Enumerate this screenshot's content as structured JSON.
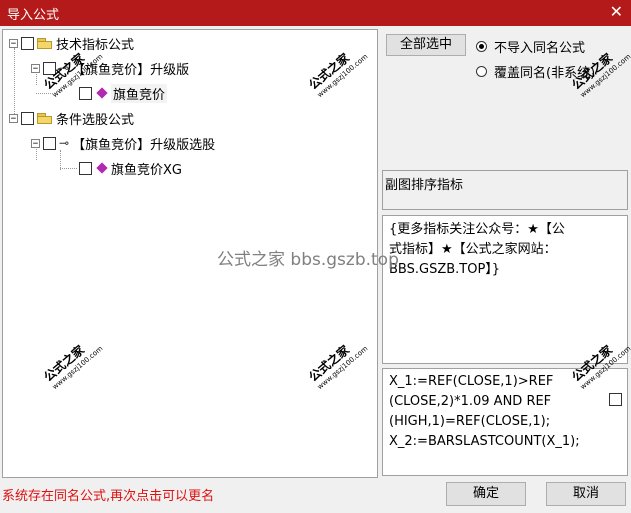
{
  "window": {
    "title": "导入公式",
    "close_glyph": "✕"
  },
  "tree": {
    "root1": {
      "label": "技术指标公式"
    },
    "node1": {
      "label": "【旗鱼竞价】升级版"
    },
    "leaf1": {
      "label": "旗鱼竞价"
    },
    "root2": {
      "label": "条件选股公式"
    },
    "node2": {
      "label": "【旗鱼竞价】升级版选股"
    },
    "leaf2": {
      "label": "旗鱼竞价XG"
    },
    "expander_glyph": "−",
    "key_glyph": "⊸"
  },
  "controls": {
    "select_all": "全部选中",
    "radio_skip": "不导入同名公式",
    "radio_overwrite": "覆盖同名(非系统)",
    "radio_selected": "radio_skip"
  },
  "panels": {
    "chart_order_label": "副图排序指标",
    "description": "{更多指标关注公众号：★【公\n式指标】★【公式之家网站：\nBBS.GSZB.TOP】}",
    "code": "X_1:=REF(CLOSE,1)>REF\n(CLOSE,2)*1.09 AND REF\n(HIGH,1)=REF(CLOSE,1);\nX_2:=BARSLASTCOUNT(X_1);"
  },
  "watermarks": {
    "center": "公式之家 bbs.gszb.top",
    "stamp_text": "公式之家",
    "stamp_url": "www.gszj100.com"
  },
  "status": {
    "message": "系统存在同名公式,再次点击可以更名"
  },
  "buttons": {
    "ok": "确定",
    "cancel": "取消"
  }
}
